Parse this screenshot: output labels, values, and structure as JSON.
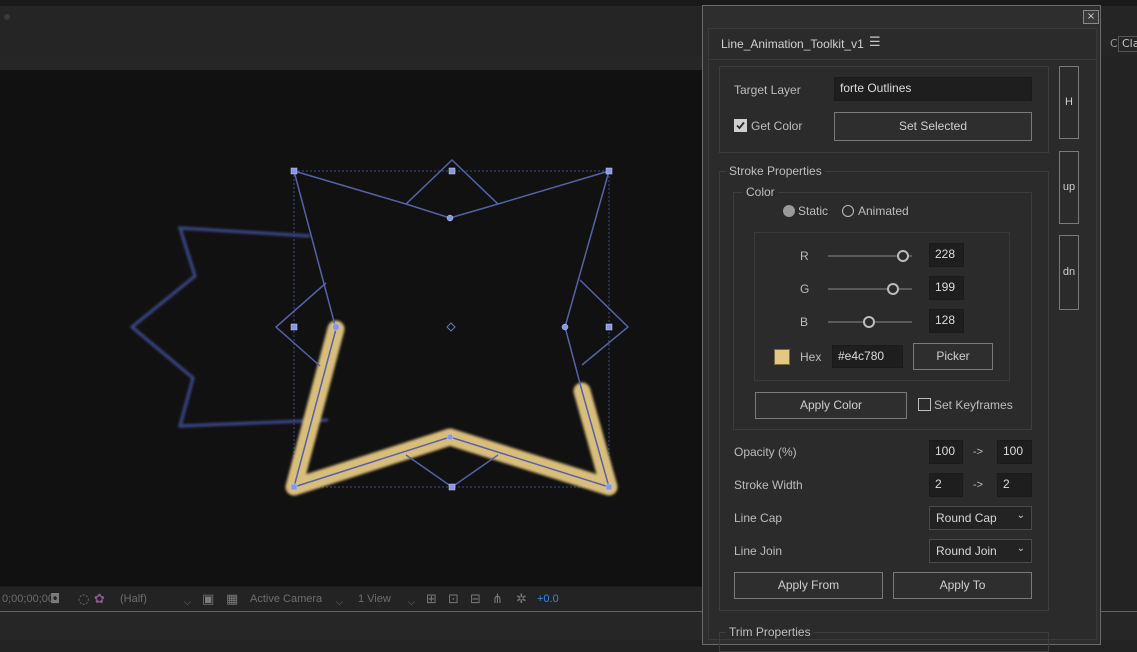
{
  "panel": {
    "title": "Line_Animation_Toolkit_v1",
    "close_glyph": "×",
    "menu_glyph": "☰",
    "side_buttons": {
      "h": "H",
      "up": "up",
      "dn": "dn"
    }
  },
  "target": {
    "label": "Target Layer",
    "value": "forte Outlines",
    "get_color_label": "Get Color",
    "get_color_checked": true,
    "set_selected_label": "Set Selected"
  },
  "stroke": {
    "group_label": "Stroke Properties",
    "color_group_label": "Color",
    "mode_static": "Static",
    "mode_animated": "Animated",
    "mode_selected": "Static",
    "r_label": "R",
    "r_value": "228",
    "g_label": "G",
    "g_value": "199",
    "b_label": "B",
    "b_value": "128",
    "hex_label": "Hex",
    "hex_value": "#e4c780",
    "swatch_color": "#e4c780",
    "picker_label": "Picker",
    "apply_color_label": "Apply Color",
    "set_keyframes_label": "Set Keyframes",
    "opacity_label": "Opacity (%)",
    "opacity_from": "100",
    "opacity_to": "100",
    "width_label": "Stroke Width",
    "width_from": "2",
    "width_to": "2",
    "arrow": "->",
    "cap_label": "Line Cap",
    "cap_value": "Round Cap",
    "join_label": "Line Join",
    "join_value": "Round Join",
    "apply_from_label": "Apply From",
    "apply_to_label": "Apply To"
  },
  "trim": {
    "group_label": "Trim Properties"
  },
  "app": {
    "right_edge_char": "C",
    "right_edge_value": "Cla",
    "toolbar": {
      "time": "0;00;00;00",
      "resolution": "(Half)",
      "camera": "Active Camera",
      "views": "1 View",
      "exposure": "+0.0"
    },
    "colors": {
      "accent_blue": "#2d6cc0",
      "stroke_yellow": "#e4c780",
      "path_blue": "#4c5aa0"
    }
  }
}
